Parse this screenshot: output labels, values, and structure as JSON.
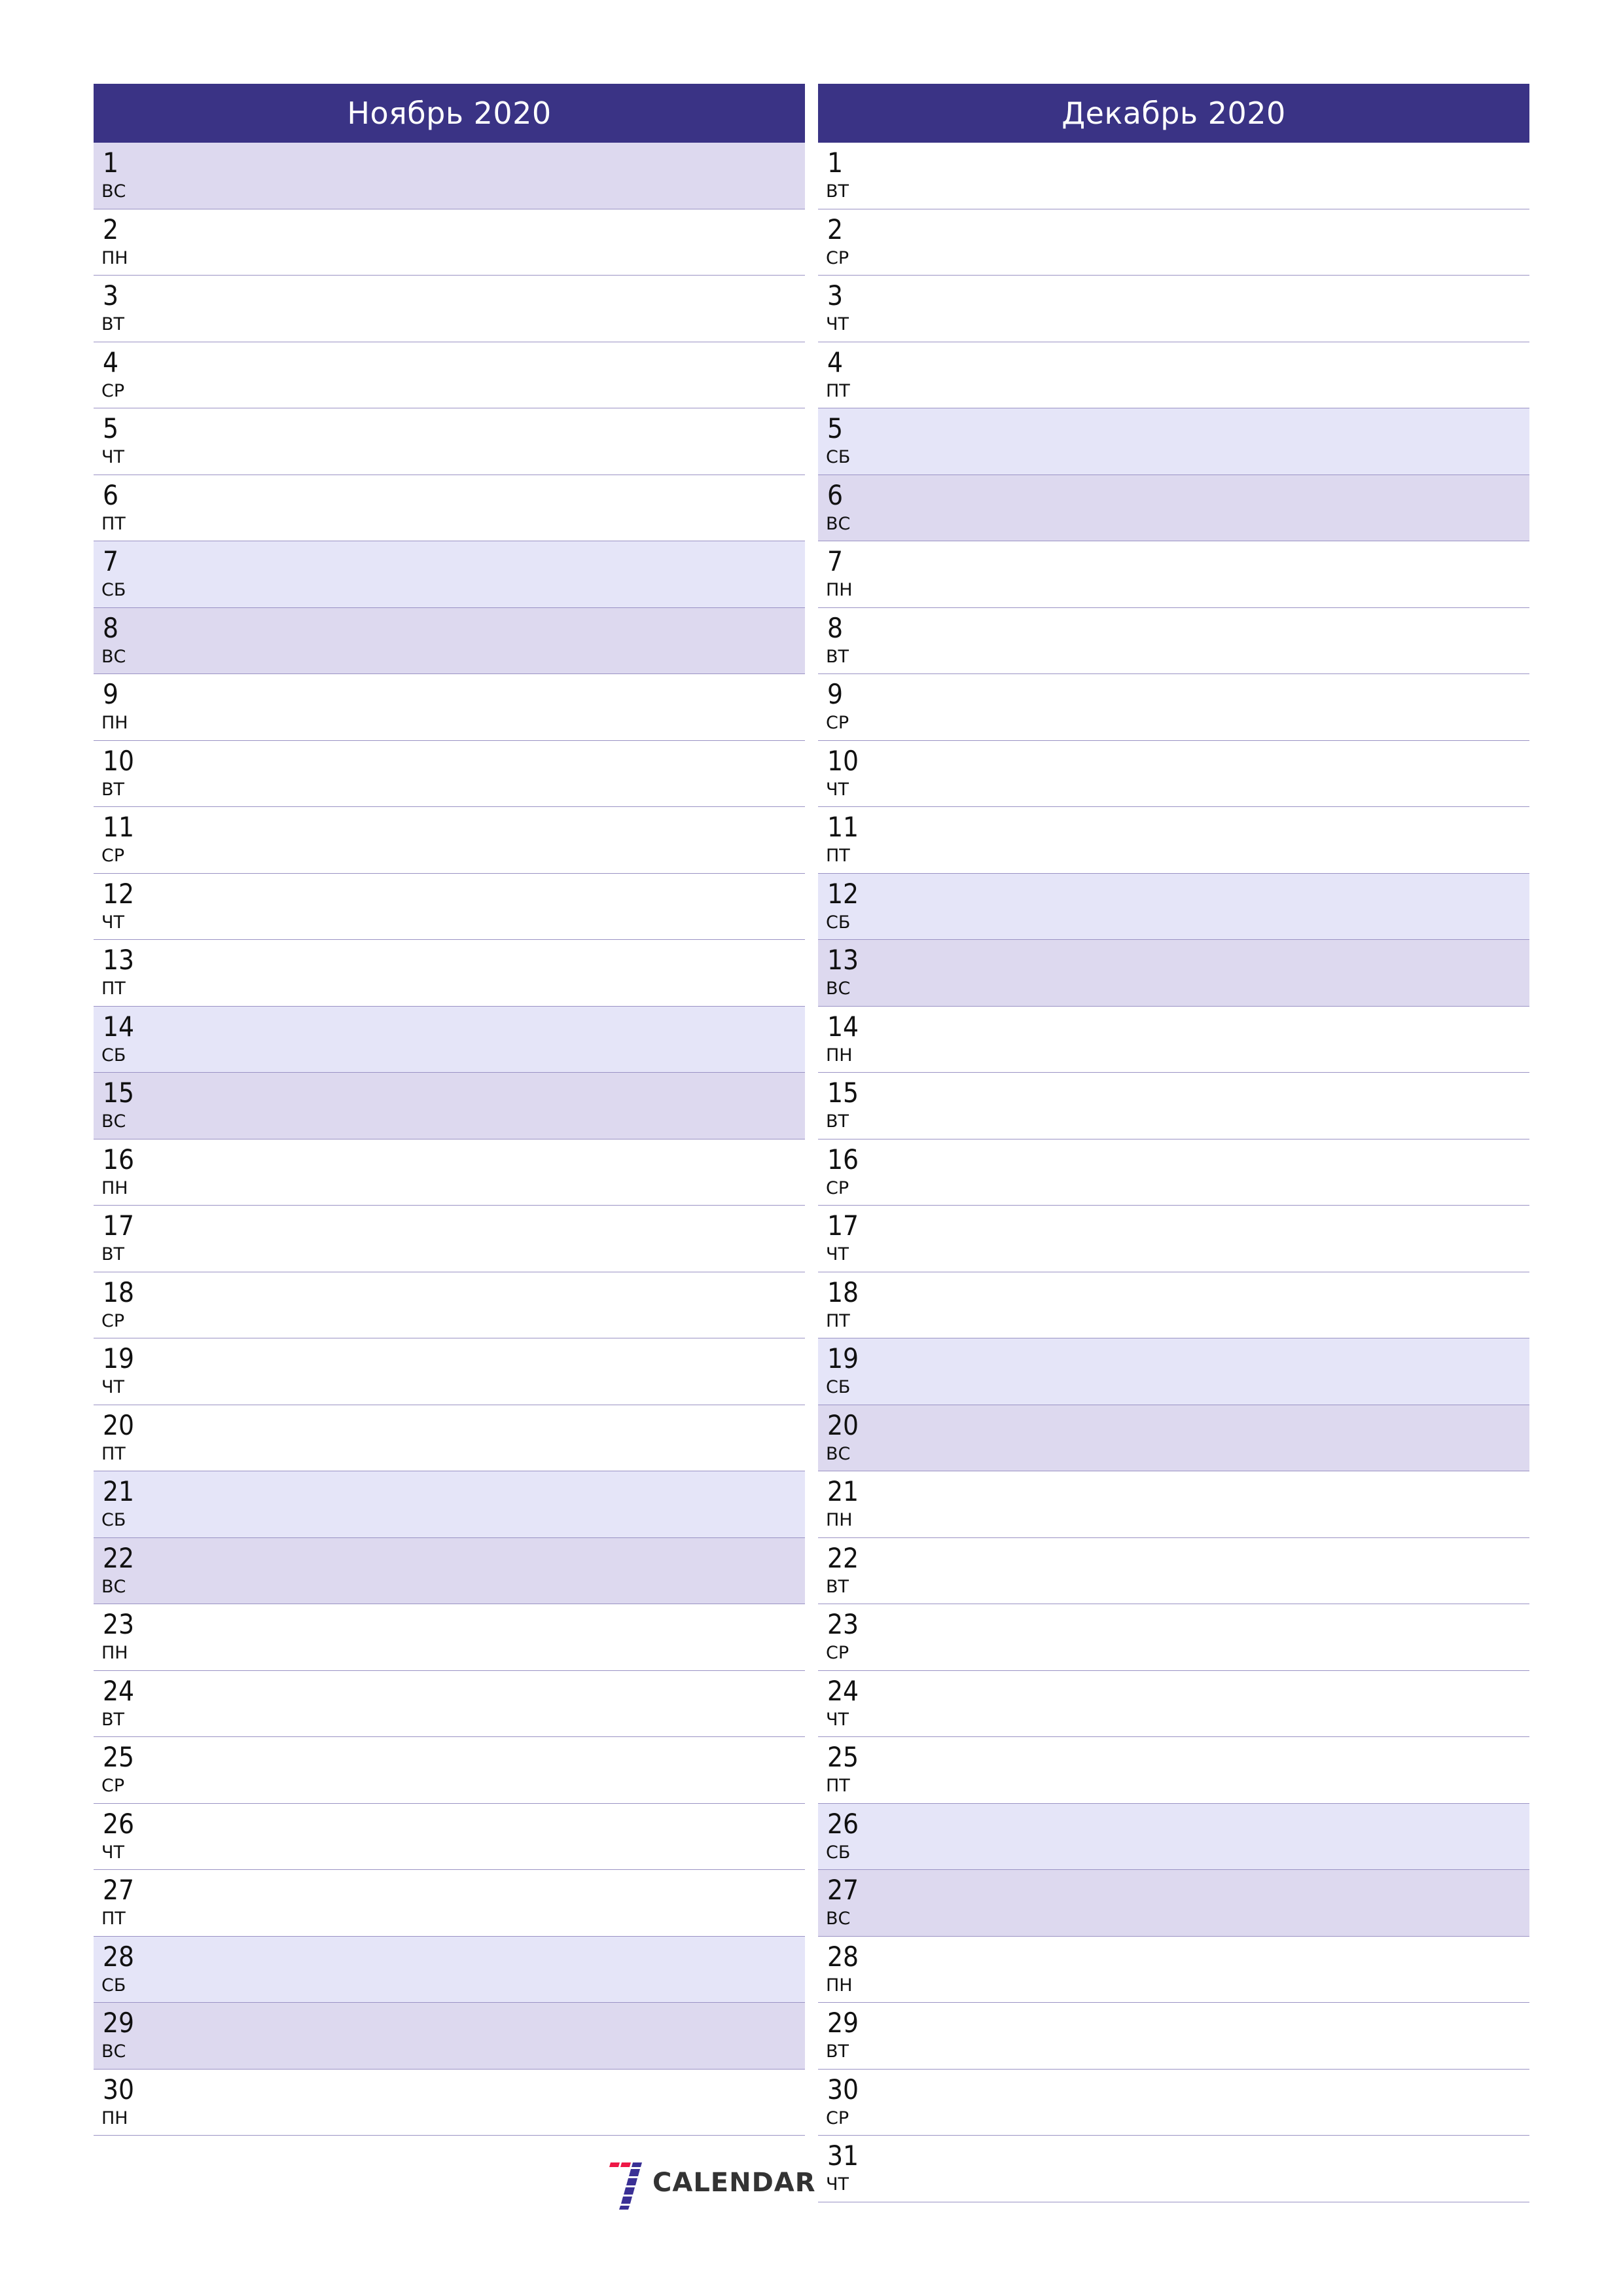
{
  "colors": {
    "header_bg": "#3a3385",
    "saturday_bg": "#e5e5f8",
    "sunday_bg": "#ddd9ef",
    "divider": "#9a92c4",
    "logo_red": "#ee1846",
    "logo_blue": "#3a3095"
  },
  "months": [
    {
      "title": "Ноябрь 2020",
      "days": [
        {
          "num": "1",
          "name": "ВС",
          "type": "sun"
        },
        {
          "num": "2",
          "name": "ПН",
          "type": "wd"
        },
        {
          "num": "3",
          "name": "ВТ",
          "type": "wd"
        },
        {
          "num": "4",
          "name": "СР",
          "type": "wd"
        },
        {
          "num": "5",
          "name": "ЧТ",
          "type": "wd"
        },
        {
          "num": "6",
          "name": "ПТ",
          "type": "wd"
        },
        {
          "num": "7",
          "name": "СБ",
          "type": "sat"
        },
        {
          "num": "8",
          "name": "ВС",
          "type": "sun"
        },
        {
          "num": "9",
          "name": "ПН",
          "type": "wd"
        },
        {
          "num": "10",
          "name": "ВТ",
          "type": "wd"
        },
        {
          "num": "11",
          "name": "СР",
          "type": "wd"
        },
        {
          "num": "12",
          "name": "ЧТ",
          "type": "wd"
        },
        {
          "num": "13",
          "name": "ПТ",
          "type": "wd"
        },
        {
          "num": "14",
          "name": "СБ",
          "type": "sat"
        },
        {
          "num": "15",
          "name": "ВС",
          "type": "sun"
        },
        {
          "num": "16",
          "name": "ПН",
          "type": "wd"
        },
        {
          "num": "17",
          "name": "ВТ",
          "type": "wd"
        },
        {
          "num": "18",
          "name": "СР",
          "type": "wd"
        },
        {
          "num": "19",
          "name": "ЧТ",
          "type": "wd"
        },
        {
          "num": "20",
          "name": "ПТ",
          "type": "wd"
        },
        {
          "num": "21",
          "name": "СБ",
          "type": "sat"
        },
        {
          "num": "22",
          "name": "ВС",
          "type": "sun"
        },
        {
          "num": "23",
          "name": "ПН",
          "type": "wd"
        },
        {
          "num": "24",
          "name": "ВТ",
          "type": "wd"
        },
        {
          "num": "25",
          "name": "СР",
          "type": "wd"
        },
        {
          "num": "26",
          "name": "ЧТ",
          "type": "wd"
        },
        {
          "num": "27",
          "name": "ПТ",
          "type": "wd"
        },
        {
          "num": "28",
          "name": "СБ",
          "type": "sat"
        },
        {
          "num": "29",
          "name": "ВС",
          "type": "sun"
        },
        {
          "num": "30",
          "name": "ПН",
          "type": "wd"
        }
      ]
    },
    {
      "title": "Декабрь 2020",
      "days": [
        {
          "num": "1",
          "name": "ВТ",
          "type": "wd"
        },
        {
          "num": "2",
          "name": "СР",
          "type": "wd"
        },
        {
          "num": "3",
          "name": "ЧТ",
          "type": "wd"
        },
        {
          "num": "4",
          "name": "ПТ",
          "type": "wd"
        },
        {
          "num": "5",
          "name": "СБ",
          "type": "sat"
        },
        {
          "num": "6",
          "name": "ВС",
          "type": "sun"
        },
        {
          "num": "7",
          "name": "ПН",
          "type": "wd"
        },
        {
          "num": "8",
          "name": "ВТ",
          "type": "wd"
        },
        {
          "num": "9",
          "name": "СР",
          "type": "wd"
        },
        {
          "num": "10",
          "name": "ЧТ",
          "type": "wd"
        },
        {
          "num": "11",
          "name": "ПТ",
          "type": "wd"
        },
        {
          "num": "12",
          "name": "СБ",
          "type": "sat"
        },
        {
          "num": "13",
          "name": "ВС",
          "type": "sun"
        },
        {
          "num": "14",
          "name": "ПН",
          "type": "wd"
        },
        {
          "num": "15",
          "name": "ВТ",
          "type": "wd"
        },
        {
          "num": "16",
          "name": "СР",
          "type": "wd"
        },
        {
          "num": "17",
          "name": "ЧТ",
          "type": "wd"
        },
        {
          "num": "18",
          "name": "ПТ",
          "type": "wd"
        },
        {
          "num": "19",
          "name": "СБ",
          "type": "sat"
        },
        {
          "num": "20",
          "name": "ВС",
          "type": "sun"
        },
        {
          "num": "21",
          "name": "ПН",
          "type": "wd"
        },
        {
          "num": "22",
          "name": "ВТ",
          "type": "wd"
        },
        {
          "num": "23",
          "name": "СР",
          "type": "wd"
        },
        {
          "num": "24",
          "name": "ЧТ",
          "type": "wd"
        },
        {
          "num": "25",
          "name": "ПТ",
          "type": "wd"
        },
        {
          "num": "26",
          "name": "СБ",
          "type": "sat"
        },
        {
          "num": "27",
          "name": "ВС",
          "type": "sun"
        },
        {
          "num": "28",
          "name": "ПН",
          "type": "wd"
        },
        {
          "num": "29",
          "name": "ВТ",
          "type": "wd"
        },
        {
          "num": "30",
          "name": "СР",
          "type": "wd"
        },
        {
          "num": "31",
          "name": "ЧТ",
          "type": "wd"
        }
      ]
    }
  ],
  "logo": {
    "icon": "seven-calendar-logo-icon",
    "text": "CALENDAR"
  }
}
